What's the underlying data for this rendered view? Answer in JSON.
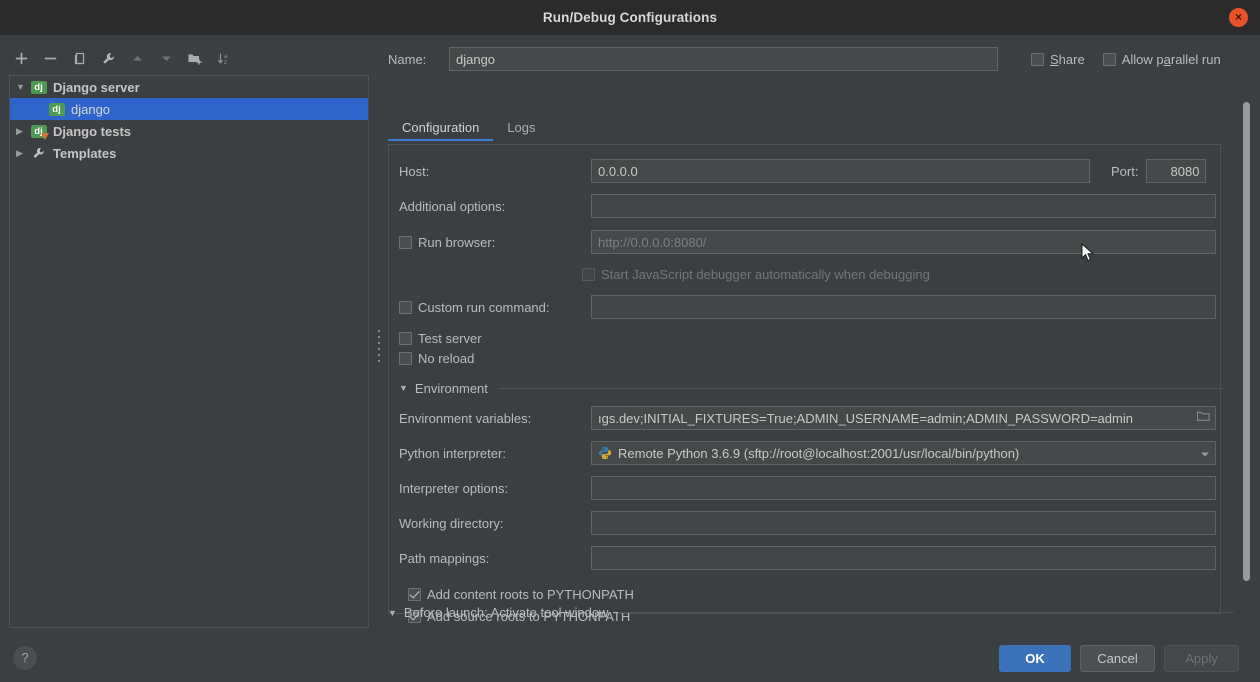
{
  "window": {
    "title": "Run/Debug Configurations",
    "close_icon": "close-icon",
    "close_label": "×"
  },
  "toolbar": {
    "buttons": [
      {
        "name": "add-configuration-button",
        "icon": "plus-icon",
        "title": "Add New Configuration"
      },
      {
        "name": "remove-configuration-button",
        "icon": "minus-icon",
        "title": "Remove Configuration"
      },
      {
        "name": "copy-configuration-button",
        "icon": "copy-icon",
        "title": "Copy Configuration"
      },
      {
        "name": "edit-templates-button",
        "icon": "wrench-icon",
        "title": "Edit Templates"
      },
      {
        "name": "move-up-button",
        "icon": "arrow-up-icon",
        "title": "Move Up"
      },
      {
        "name": "move-down-button",
        "icon": "arrow-down-icon",
        "title": "Move Down"
      },
      {
        "name": "new-folder-button",
        "icon": "folder-add-icon",
        "title": "Create New Folder"
      },
      {
        "name": "sort-configurations-button",
        "icon": "sort-az-icon",
        "title": "Sort Configurations"
      }
    ]
  },
  "tree": {
    "items": [
      {
        "label": "Django server",
        "icon": "django-icon",
        "expanded": true,
        "twisty": "▼",
        "level": 0,
        "selected": false
      },
      {
        "label": "django",
        "icon": "django-icon",
        "expanded": false,
        "twisty": "",
        "level": 1,
        "selected": true
      },
      {
        "label": "Django tests",
        "icon": "django-tests-icon",
        "expanded": false,
        "twisty": "▶",
        "level": 0,
        "selected": false
      },
      {
        "label": "Templates",
        "icon": "wrench-icon",
        "expanded": false,
        "twisty": "▶",
        "level": 0,
        "selected": false
      }
    ]
  },
  "name_row": {
    "label": "Name:",
    "value": "django",
    "placeholder": "",
    "share": {
      "label": "Share",
      "underline_char": "S",
      "rest": "hare",
      "checked": false
    },
    "allow_parallel": {
      "label": "Allow parallel run",
      "pre": "Allow p",
      "underline_char": "a",
      "post": "rallel run",
      "checked": false
    }
  },
  "tabs": [
    {
      "label": "Configuration",
      "active": true
    },
    {
      "label": "Logs",
      "active": false
    }
  ],
  "form": {
    "host": {
      "label": "Host:",
      "value": "0.0.0.0",
      "placeholder": ""
    },
    "port": {
      "label": "Port:",
      "value": "8080"
    },
    "additional_options": {
      "label": "Additional options:",
      "value": "",
      "placeholder": ""
    },
    "run_browser": {
      "label": "Run browser:",
      "checked": false,
      "value": "",
      "placeholder": "http://0.0.0.0:8080/"
    },
    "start_js_debugger": {
      "label": "Start JavaScript debugger automatically when debugging",
      "checked": false,
      "disabled": true
    },
    "custom_run_command": {
      "label": "Custom run command:",
      "checked": false,
      "value": "",
      "placeholder": ""
    },
    "test_server": {
      "label": "Test server",
      "checked": false
    },
    "no_reload": {
      "label": "No reload",
      "checked": false
    },
    "environment_section": {
      "title": "Environment",
      "arrow": "▼",
      "expanded": true
    },
    "environment_variables": {
      "label": "Environment variables:",
      "value": "ıgs.dev;INITIAL_FIXTURES=True;ADMIN_USERNAME=admin;ADMIN_PASSWORD=admin",
      "browse_icon": "folder-browse-icon"
    },
    "python_interpreter": {
      "label": "Python interpreter:",
      "value": "Remote Python 3.6.9 (sftp://root@localhost:2001/usr/local/bin/python)",
      "icon": "python-icon",
      "dropdown_icon": "chevron-down-icon"
    },
    "interpreter_options": {
      "label": "Interpreter options:",
      "value": "",
      "placeholder": "",
      "expand_icon": "expand-editor-icon"
    },
    "working_directory": {
      "label": "Working directory:",
      "value": "",
      "placeholder": "",
      "browse_icon": "folder-browse-icon"
    },
    "path_mappings": {
      "label": "Path mappings:",
      "value": "",
      "placeholder": "",
      "browse_icon": "folder-browse-icon"
    },
    "add_content_roots": {
      "label": "Add content roots to PYTHONPATH",
      "checked": true
    },
    "add_source_roots": {
      "label": "Add source roots to PYTHONPATH",
      "checked": true
    }
  },
  "before_launch": {
    "arrow": "▼",
    "title": "Before launch: Activate tool window"
  },
  "footer": {
    "help_label": "?",
    "ok_label": "OK",
    "cancel_label": "Cancel",
    "apply_label": "Apply",
    "apply_disabled": true
  },
  "colors": {
    "background": "#3c3f41",
    "titlebar": "#2b2b2b",
    "accent_blue": "#3b7fd4",
    "selection_blue": "#2f65ca",
    "primary_button": "#3b72ba",
    "close_red": "#e8522a",
    "django_green": "#4f9a52",
    "text": "#bbbbbb",
    "field_background": "#45494a"
  }
}
